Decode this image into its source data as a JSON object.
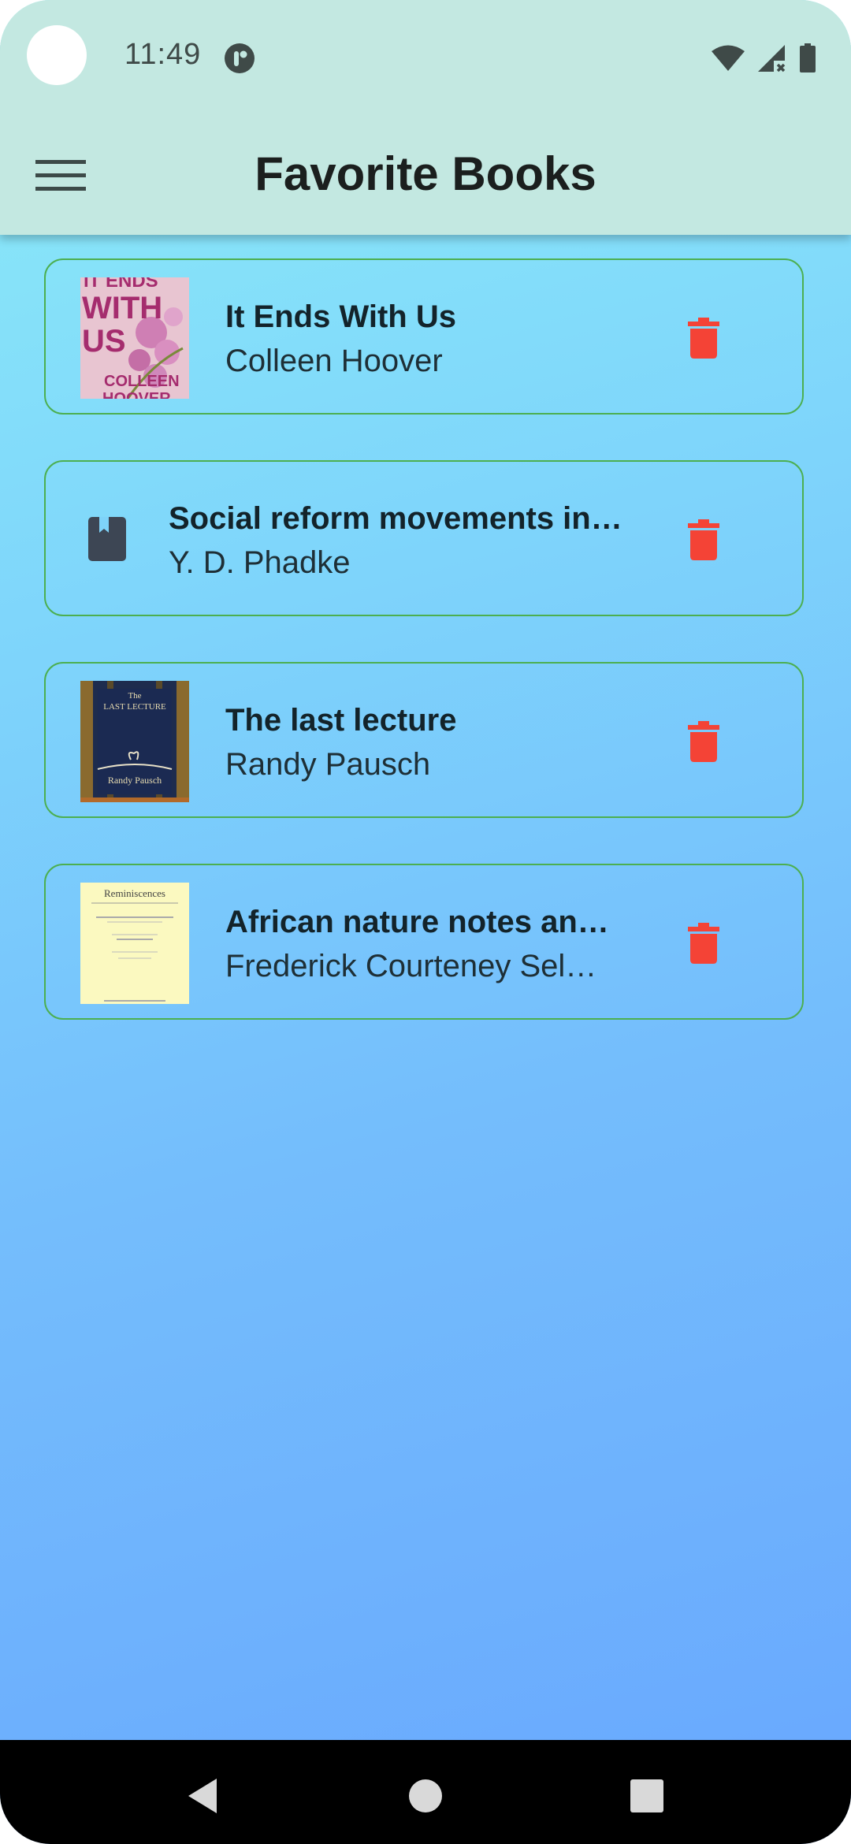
{
  "status_bar": {
    "time": "11:49"
  },
  "app_bar": {
    "title": "Favorite Books",
    "menu_icon": "hamburger-menu-icon"
  },
  "books": [
    {
      "title": "It Ends With Us",
      "author": "Colleen Hoover",
      "cover_text_lines": [
        "IT ENDS",
        "WITH",
        "US",
        "COLLEEN",
        "HOOVER"
      ],
      "cover": "it-ends-with-us"
    },
    {
      "title": "Social reform movements in…",
      "author": "Y. D. Phadke",
      "cover": "none"
    },
    {
      "title": "The last lecture",
      "author": "Randy Pausch",
      "cover_text_lines": [
        "The",
        "LAST LECTURE",
        "Randy Pausch"
      ],
      "cover": "last-lecture"
    },
    {
      "title": "African nature notes an…",
      "author": "Frederick Courteney Sel…",
      "cover_text_lines": [
        "Reminiscences"
      ],
      "cover": "african-nature"
    }
  ],
  "colors": {
    "app_bar": "#c3e8e1",
    "card_border": "#4caf50",
    "delete": "#f44336"
  }
}
